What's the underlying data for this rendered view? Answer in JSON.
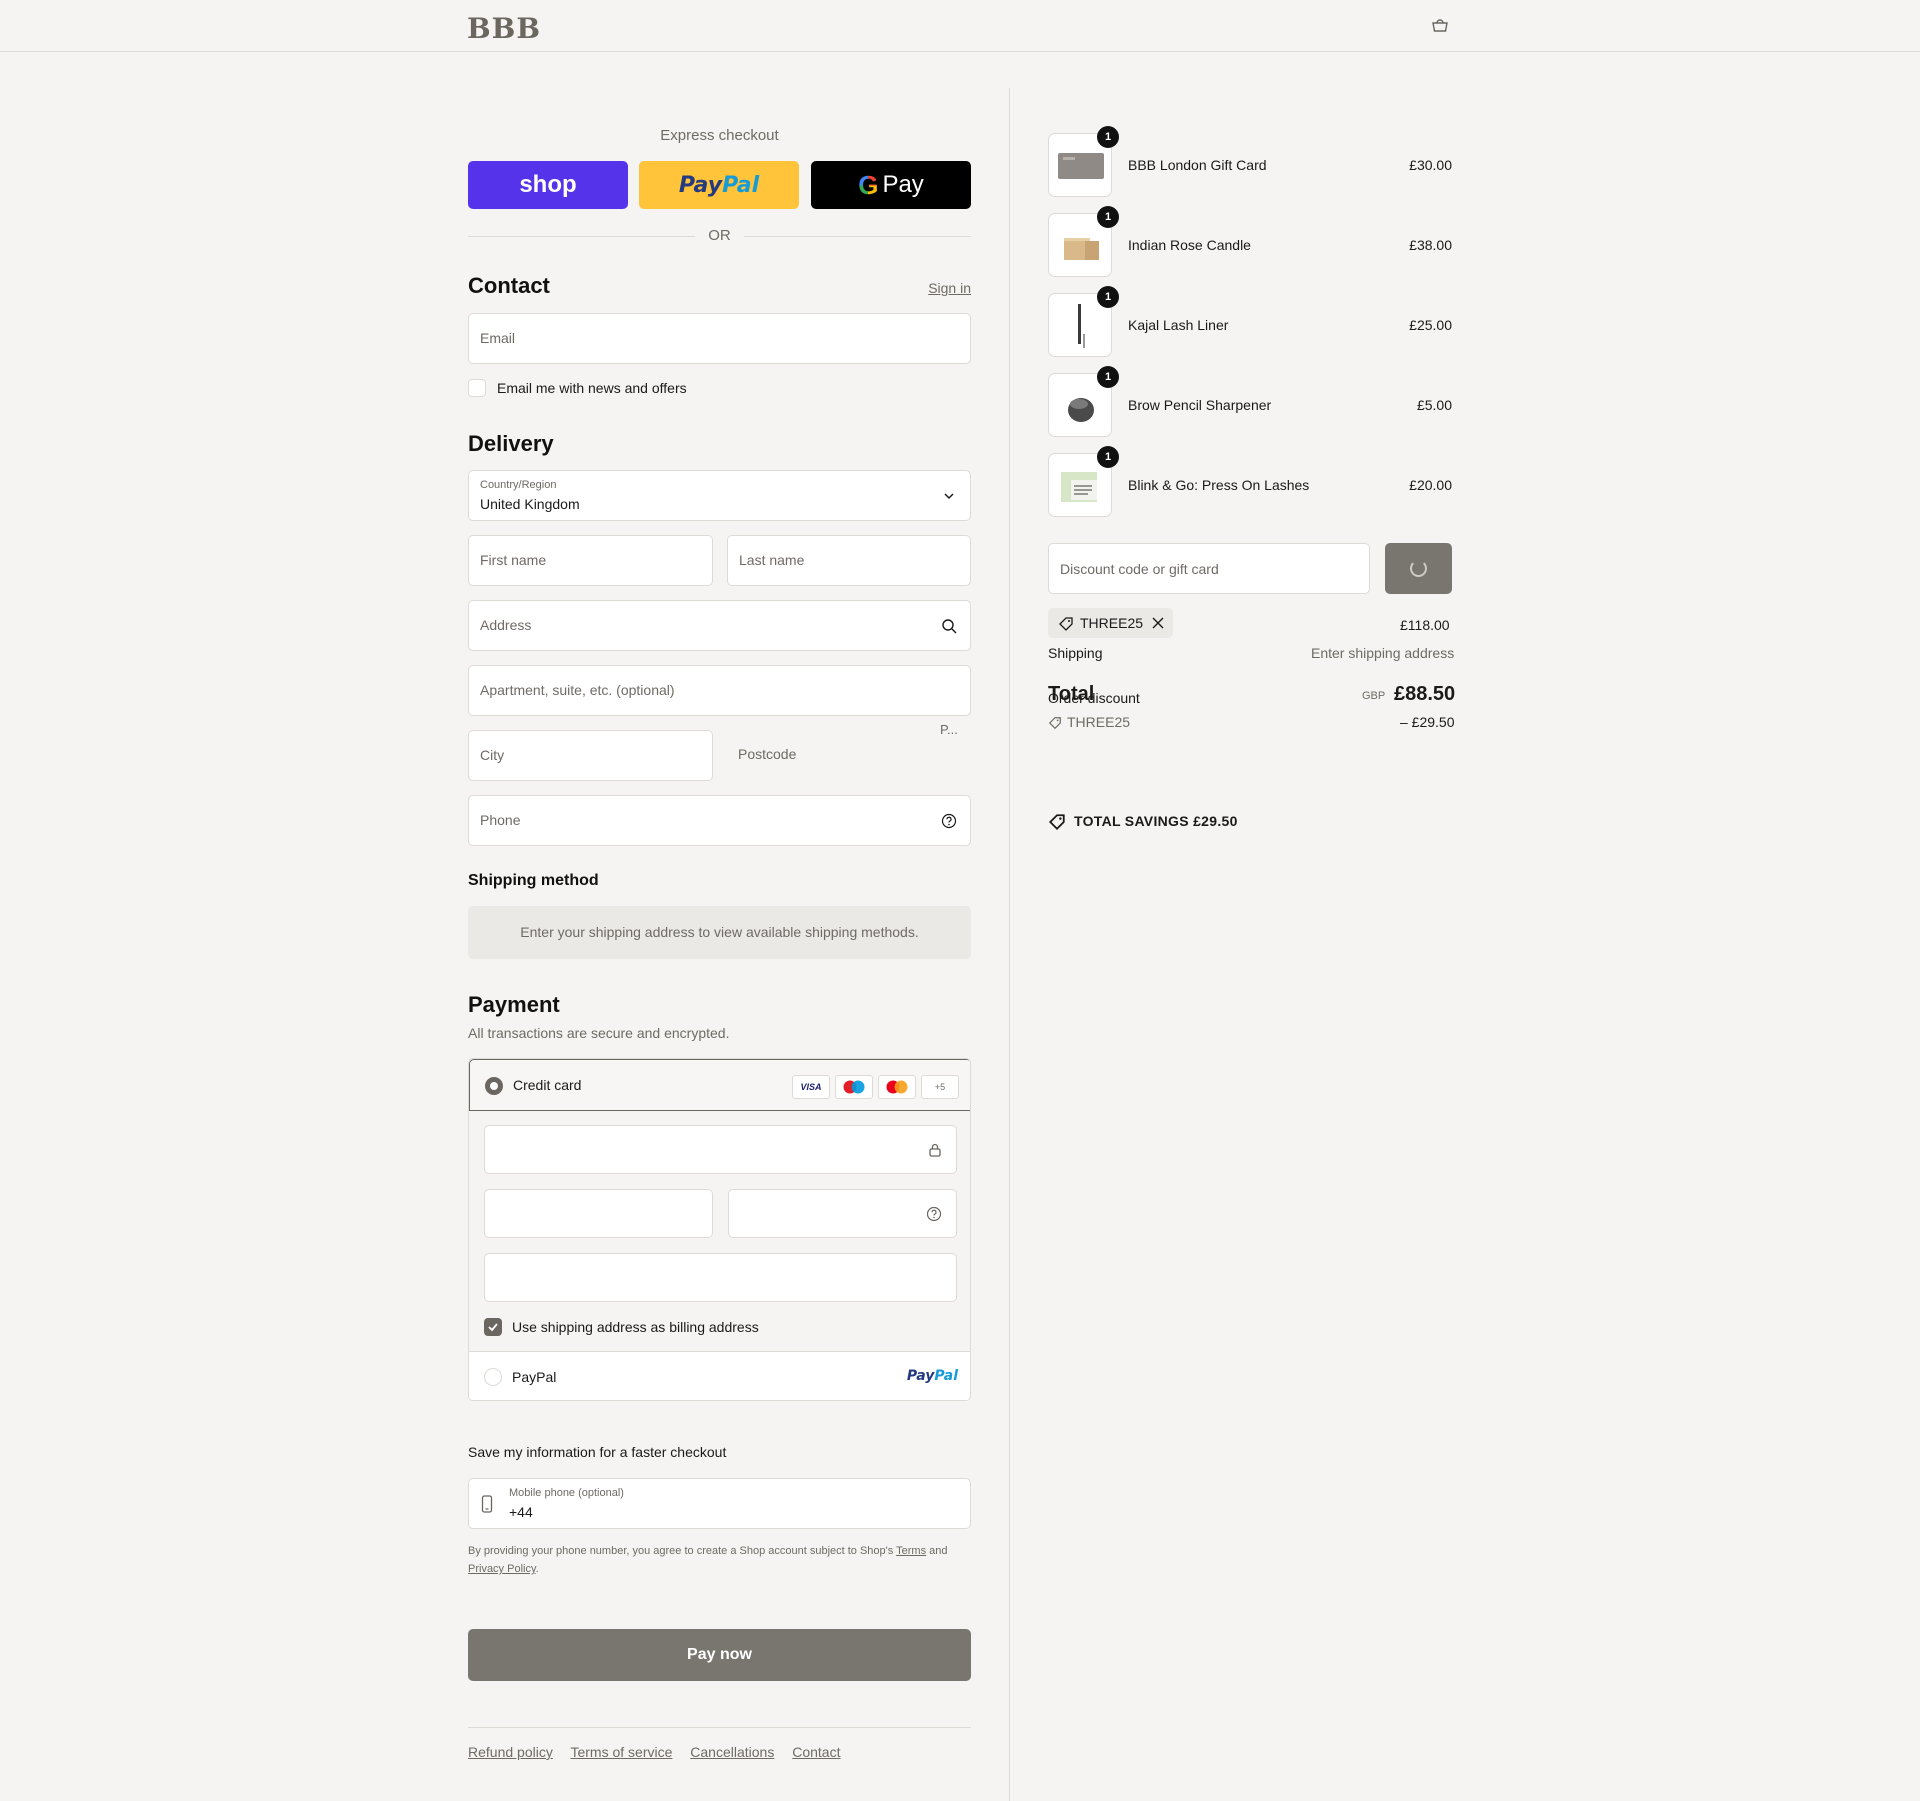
{
  "header": {
    "logo": "BBB"
  },
  "express": {
    "title": "Express checkout",
    "shop_label": "shop",
    "paypal_a": "Pay",
    "paypal_b": "Pal",
    "gpay_g": "G",
    "gpay_label": "Pay",
    "or": "OR"
  },
  "contact": {
    "title": "Contact",
    "signin": "Sign in",
    "email_placeholder": "Email",
    "newsletter_label": "Email me with news and offers"
  },
  "delivery": {
    "title": "Delivery",
    "country_label": "Country/Region",
    "country_value": "United Kingdom",
    "first_name": "First name",
    "last_name": "Last name",
    "address": "Address",
    "apartment": "Apartment, suite, etc. (optional)",
    "city": "City",
    "postcode": "Postcode",
    "postcode_small": "P...",
    "phone": "Phone"
  },
  "shipping": {
    "title": "Shipping method",
    "info": "Enter your shipping address to view available shipping methods."
  },
  "payment": {
    "title": "Payment",
    "note": "All transactions are secure and encrypted.",
    "credit_card": "Credit card",
    "visa": "VISA",
    "more_cards": "+5",
    "billing_label": "Use shipping address as billing address",
    "paypal_label": "PayPal"
  },
  "save_info": {
    "title": "Save my information for a faster checkout",
    "mobile_label": "Mobile phone (optional)",
    "mobile_value": "+44",
    "legal_text": "By providing your phone number, you agree to create a Shop account subject to Shop's ",
    "terms": "Terms",
    "and": " and ",
    "privacy": "Privacy Policy",
    "period": "."
  },
  "pay_now": "Pay now",
  "footer": {
    "links": [
      "Refund policy",
      "Terms of service",
      "Cancellations",
      "Contact"
    ]
  },
  "order": {
    "items": [
      {
        "name": "BBB London Gift Card",
        "price": "£30.00",
        "qty": "1"
      },
      {
        "name": "Indian Rose Candle",
        "price": "£38.00",
        "qty": "1"
      },
      {
        "name": "Kajal Lash Liner",
        "price": "£25.00",
        "qty": "1"
      },
      {
        "name": "Brow Pencil Sharpener",
        "price": "£5.00",
        "qty": "1"
      },
      {
        "name": "Blink & Go: Press On Lashes",
        "price": "£20.00",
        "qty": "1"
      }
    ],
    "discount_placeholder": "Discount code or gift card",
    "discount_code": "THREE25",
    "subtotal": "£118.00",
    "shipping_label": "Shipping",
    "shipping_value": "Enter shipping address",
    "order_discount_label": "Order discount",
    "order_discount_code": "THREE25",
    "order_discount_value": "– £29.50",
    "total_label": "Total",
    "currency": "GBP",
    "total_value": "£88.50",
    "savings": "TOTAL SAVINGS  £29.50"
  }
}
